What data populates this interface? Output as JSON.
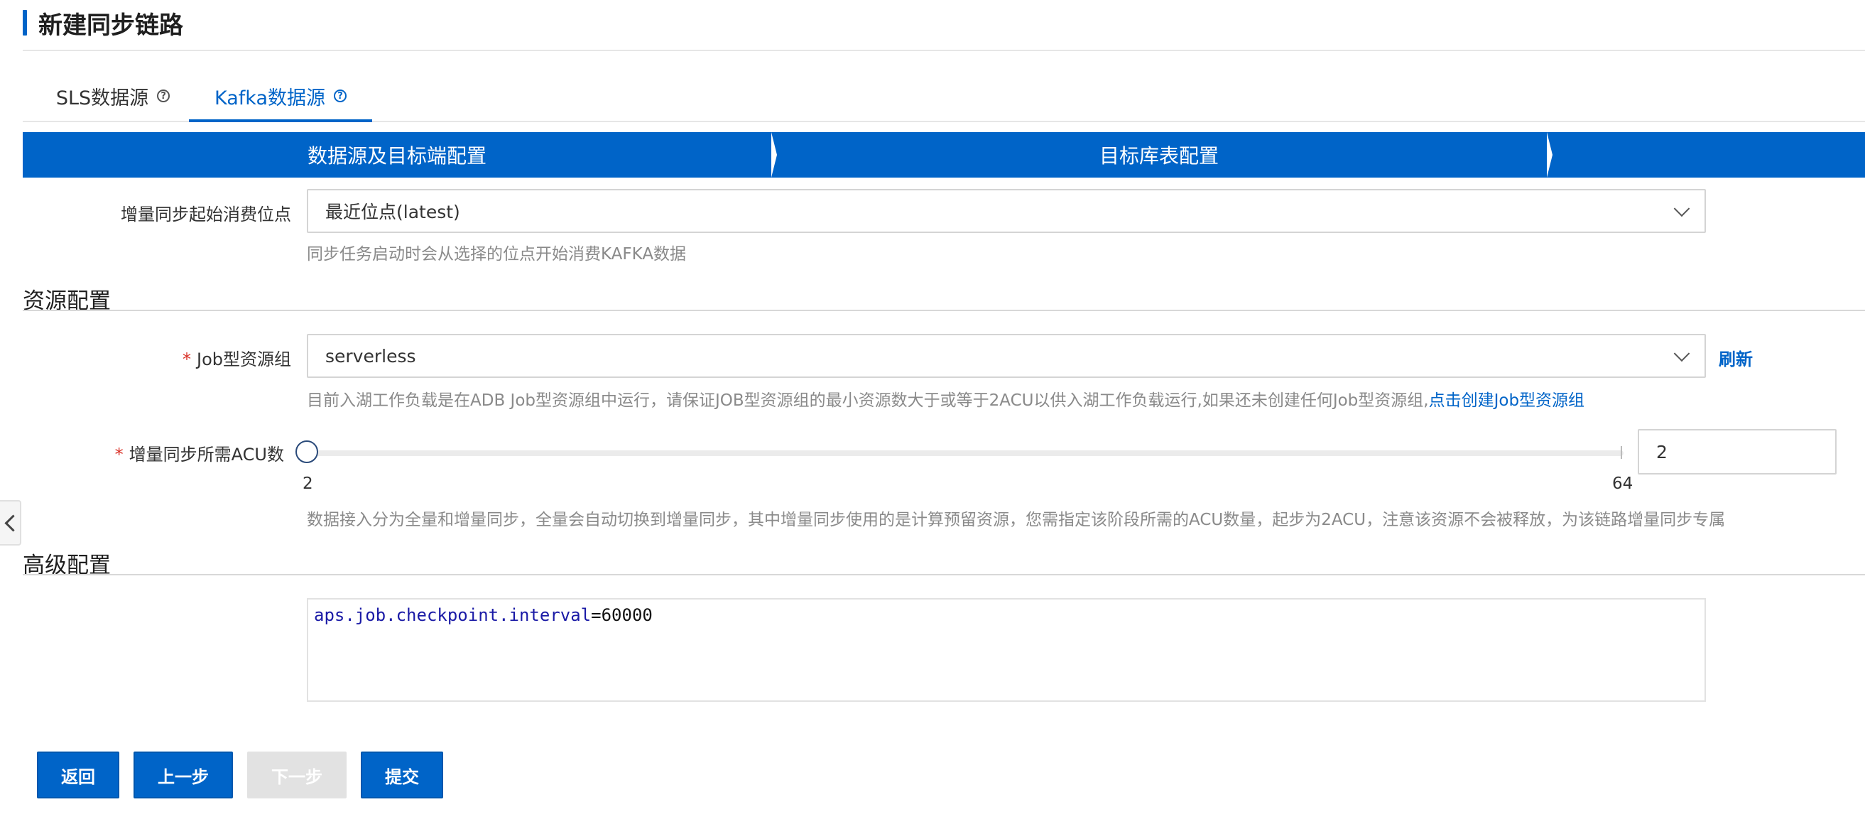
{
  "header": {
    "title": "新建同步链路"
  },
  "tabs": [
    {
      "label": "SLS数据源",
      "active": false
    },
    {
      "label": "Kafka数据源",
      "active": true
    }
  ],
  "steps": [
    {
      "label": "数据源及目标端配置"
    },
    {
      "label": "目标库表配置"
    },
    {
      "label": ""
    }
  ],
  "offset": {
    "label": "增量同步起始消费位点",
    "value": "最近位点(latest)",
    "hint": "同步任务启动时会从选择的位点开始消费KAFKA数据"
  },
  "resource_section": {
    "title": "资源配置"
  },
  "job_group": {
    "required_mark": "*",
    "label": "Job型资源组",
    "value": "serverless",
    "refresh": "刷新",
    "hint": "目前入湖工作负载是在ADB Job型资源组中运行，请保证JOB型资源组的最小资源数大于或等于2ACU以供入湖工作负载运行,如果还未创建任何Job型资源组,",
    "hint_link": "点击创建Job型资源组"
  },
  "acu": {
    "required_mark": "*",
    "label": "增量同步所需ACU数",
    "min_label": "2",
    "max_label": "64",
    "min": 2,
    "max": 64,
    "value": 2,
    "input_value": "2",
    "hint": "数据接入分为全量和增量同步，全量会自动切换到增量同步，其中增量同步使用的是计算预留资源，您需指定该阶段所需的ACU数量，起步为2ACU，注意该资源不会被释放，为该链路增量同步专属"
  },
  "advanced_section": {
    "title": "高级配置"
  },
  "advanced_config": {
    "key": "aps.job.checkpoint.interval",
    "eq": "=",
    "value": "60000"
  },
  "buttons": {
    "back": "返回",
    "prev": "上一步",
    "next": "下一步",
    "submit": "提交"
  },
  "colors": {
    "primary": "#0064c8",
    "required": "#d93026",
    "disabled": "#e2e2e2"
  }
}
